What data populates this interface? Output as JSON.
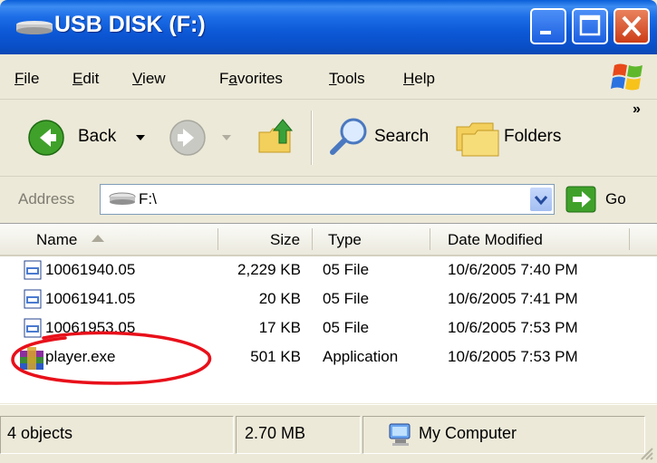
{
  "window": {
    "title": "USB DISK (F:)"
  },
  "menu": [
    {
      "label": "File",
      "ul": "F",
      "rest": "ile"
    },
    {
      "label": "Edit",
      "ul": "E",
      "rest": "dit"
    },
    {
      "label": "View",
      "ul": "V",
      "rest": "iew"
    },
    {
      "label": "Favorites",
      "pre": "F",
      "ul": "a",
      "rest": "vorites"
    },
    {
      "label": "Tools",
      "ul": "T",
      "rest": "ools"
    },
    {
      "label": "Help",
      "ul": "H",
      "rest": "elp"
    }
  ],
  "toolbar": {
    "back_label": "Back",
    "search_label": "Search",
    "folders_label": "Folders",
    "more": "»"
  },
  "address": {
    "label": "Address",
    "value": "F:\\",
    "go_label": "Go"
  },
  "columns": [
    "Name",
    "Size",
    "Type",
    "Date Modified"
  ],
  "files": [
    {
      "name": "10061940.05",
      "size": "2,229 KB",
      "type": "05 File",
      "modified": "10/6/2005 7:40 PM"
    },
    {
      "name": "10061941.05",
      "size": "20 KB",
      "type": "05 File",
      "modified": "10/6/2005 7:41 PM"
    },
    {
      "name": "10061953.05",
      "size": "17 KB",
      "type": "05 File",
      "modified": "10/6/2005 7:53 PM"
    },
    {
      "name": "player.exe",
      "size": "501 KB",
      "type": "Application",
      "modified": "10/6/2005 7:53 PM"
    }
  ],
  "status": {
    "objects": "4 objects",
    "size": "2.70 MB",
    "zone": "My Computer"
  },
  "colors": {
    "titlebar": "#0a4fc8",
    "annotation": "#e8101a",
    "close_button": "#cc3e17"
  }
}
